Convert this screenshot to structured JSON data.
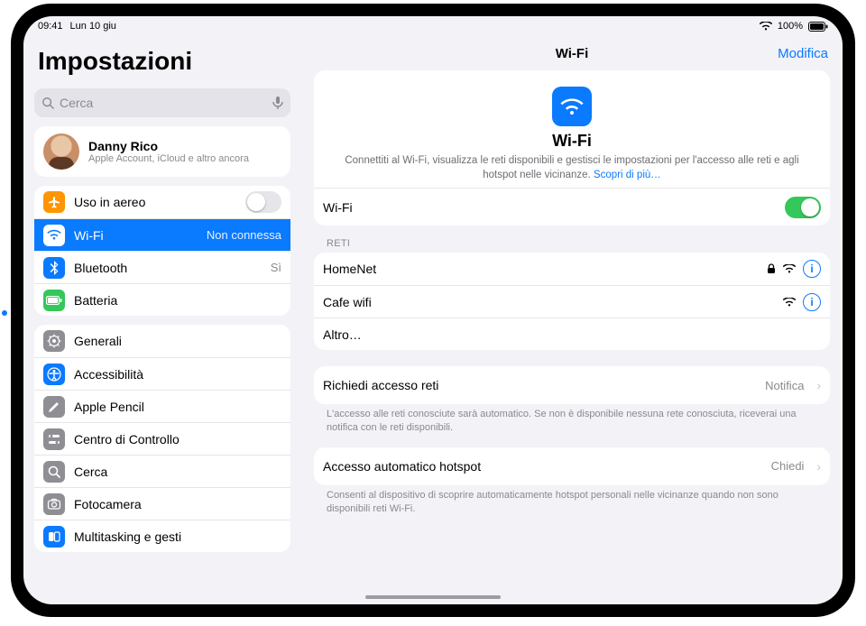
{
  "status": {
    "time": "09:41",
    "date": "Lun 10 giu",
    "battery": "100%"
  },
  "sidebar": {
    "title": "Impostazioni",
    "search_placeholder": "Cerca",
    "account": {
      "name": "Danny Rico",
      "subtitle": "Apple Account, iCloud e altro ancora"
    },
    "group1": {
      "airplane": {
        "label": "Uso in aereo"
      },
      "wifi": {
        "label": "Wi-Fi",
        "value": "Non connessa"
      },
      "bluetooth": {
        "label": "Bluetooth",
        "value": "Sì"
      },
      "battery": {
        "label": "Batteria"
      }
    },
    "group2": {
      "general": "Generali",
      "accessibility": "Accessibilità",
      "pencil": "Apple Pencil",
      "control": "Centro di Controllo",
      "search": "Cerca",
      "camera": "Fotocamera",
      "multitask": "Multitasking e gesti"
    }
  },
  "detail": {
    "nav_title": "Wi-Fi",
    "nav_edit": "Modifica",
    "hero_title": "Wi-Fi",
    "hero_text": "Connettiti al Wi-Fi, visualizza le reti disponibili e gestisci le impostazioni per l'accesso alle reti e agli hotspot nelle vicinanze.",
    "hero_link": "Scopri di più…",
    "wifi_row_label": "Wi-Fi",
    "networks_header": "Reti",
    "networks": [
      {
        "name": "HomeNet",
        "locked": true
      },
      {
        "name": "Cafe wifi",
        "locked": false
      }
    ],
    "other": "Altro…",
    "ask_join": {
      "label": "Richiedi accesso reti",
      "value": "Notifica"
    },
    "ask_join_footer": "L'accesso alle reti conosciute sarà automatico. Se non è disponibile nessuna rete conosciuta, riceverai una notifica con le reti disponibili.",
    "auto_hotspot": {
      "label": "Accesso automatico hotspot",
      "value": "Chiedi"
    },
    "auto_hotspot_footer": "Consenti al dispositivo di scoprire automaticamente hotspot personali nelle vicinanze quando non sono disponibili reti Wi-Fi."
  }
}
